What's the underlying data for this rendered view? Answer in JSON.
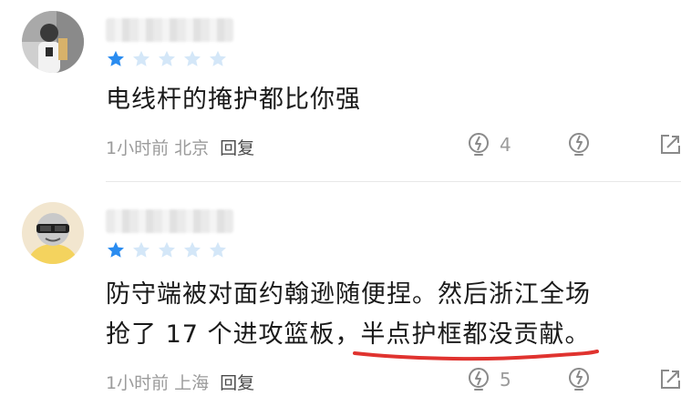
{
  "comments": [
    {
      "text": "电线杆的掩护都比你强",
      "rating": 1,
      "rating_max": 5,
      "time": "1小时前",
      "location": "北京",
      "reply_label": "回复",
      "like_count": "4",
      "avatar": "photo-avatar"
    },
    {
      "text_line1": "防守端被对面约翰逊随便捏。然后浙江全场",
      "text_line2_prefix": "抢了 17 个进攻篮板，",
      "text_line2_highlight": "半点护框都没贡献",
      "text_line2_suffix": "。",
      "rating": 1,
      "rating_max": 5,
      "time": "1小时前",
      "location": "上海",
      "reply_label": "回复",
      "like_count": "5",
      "avatar": "cartoon-sunglasses-avatar"
    }
  ],
  "colors": {
    "star_active": "#2a8cf0",
    "star_inactive": "#cfe3f7",
    "meta_text": "#9b9b9b",
    "body_text": "#1a1a1a",
    "underline": "#e0332f"
  },
  "icons": [
    "lightbulb-up-icon",
    "lightbulb-down-icon",
    "share-icon"
  ]
}
